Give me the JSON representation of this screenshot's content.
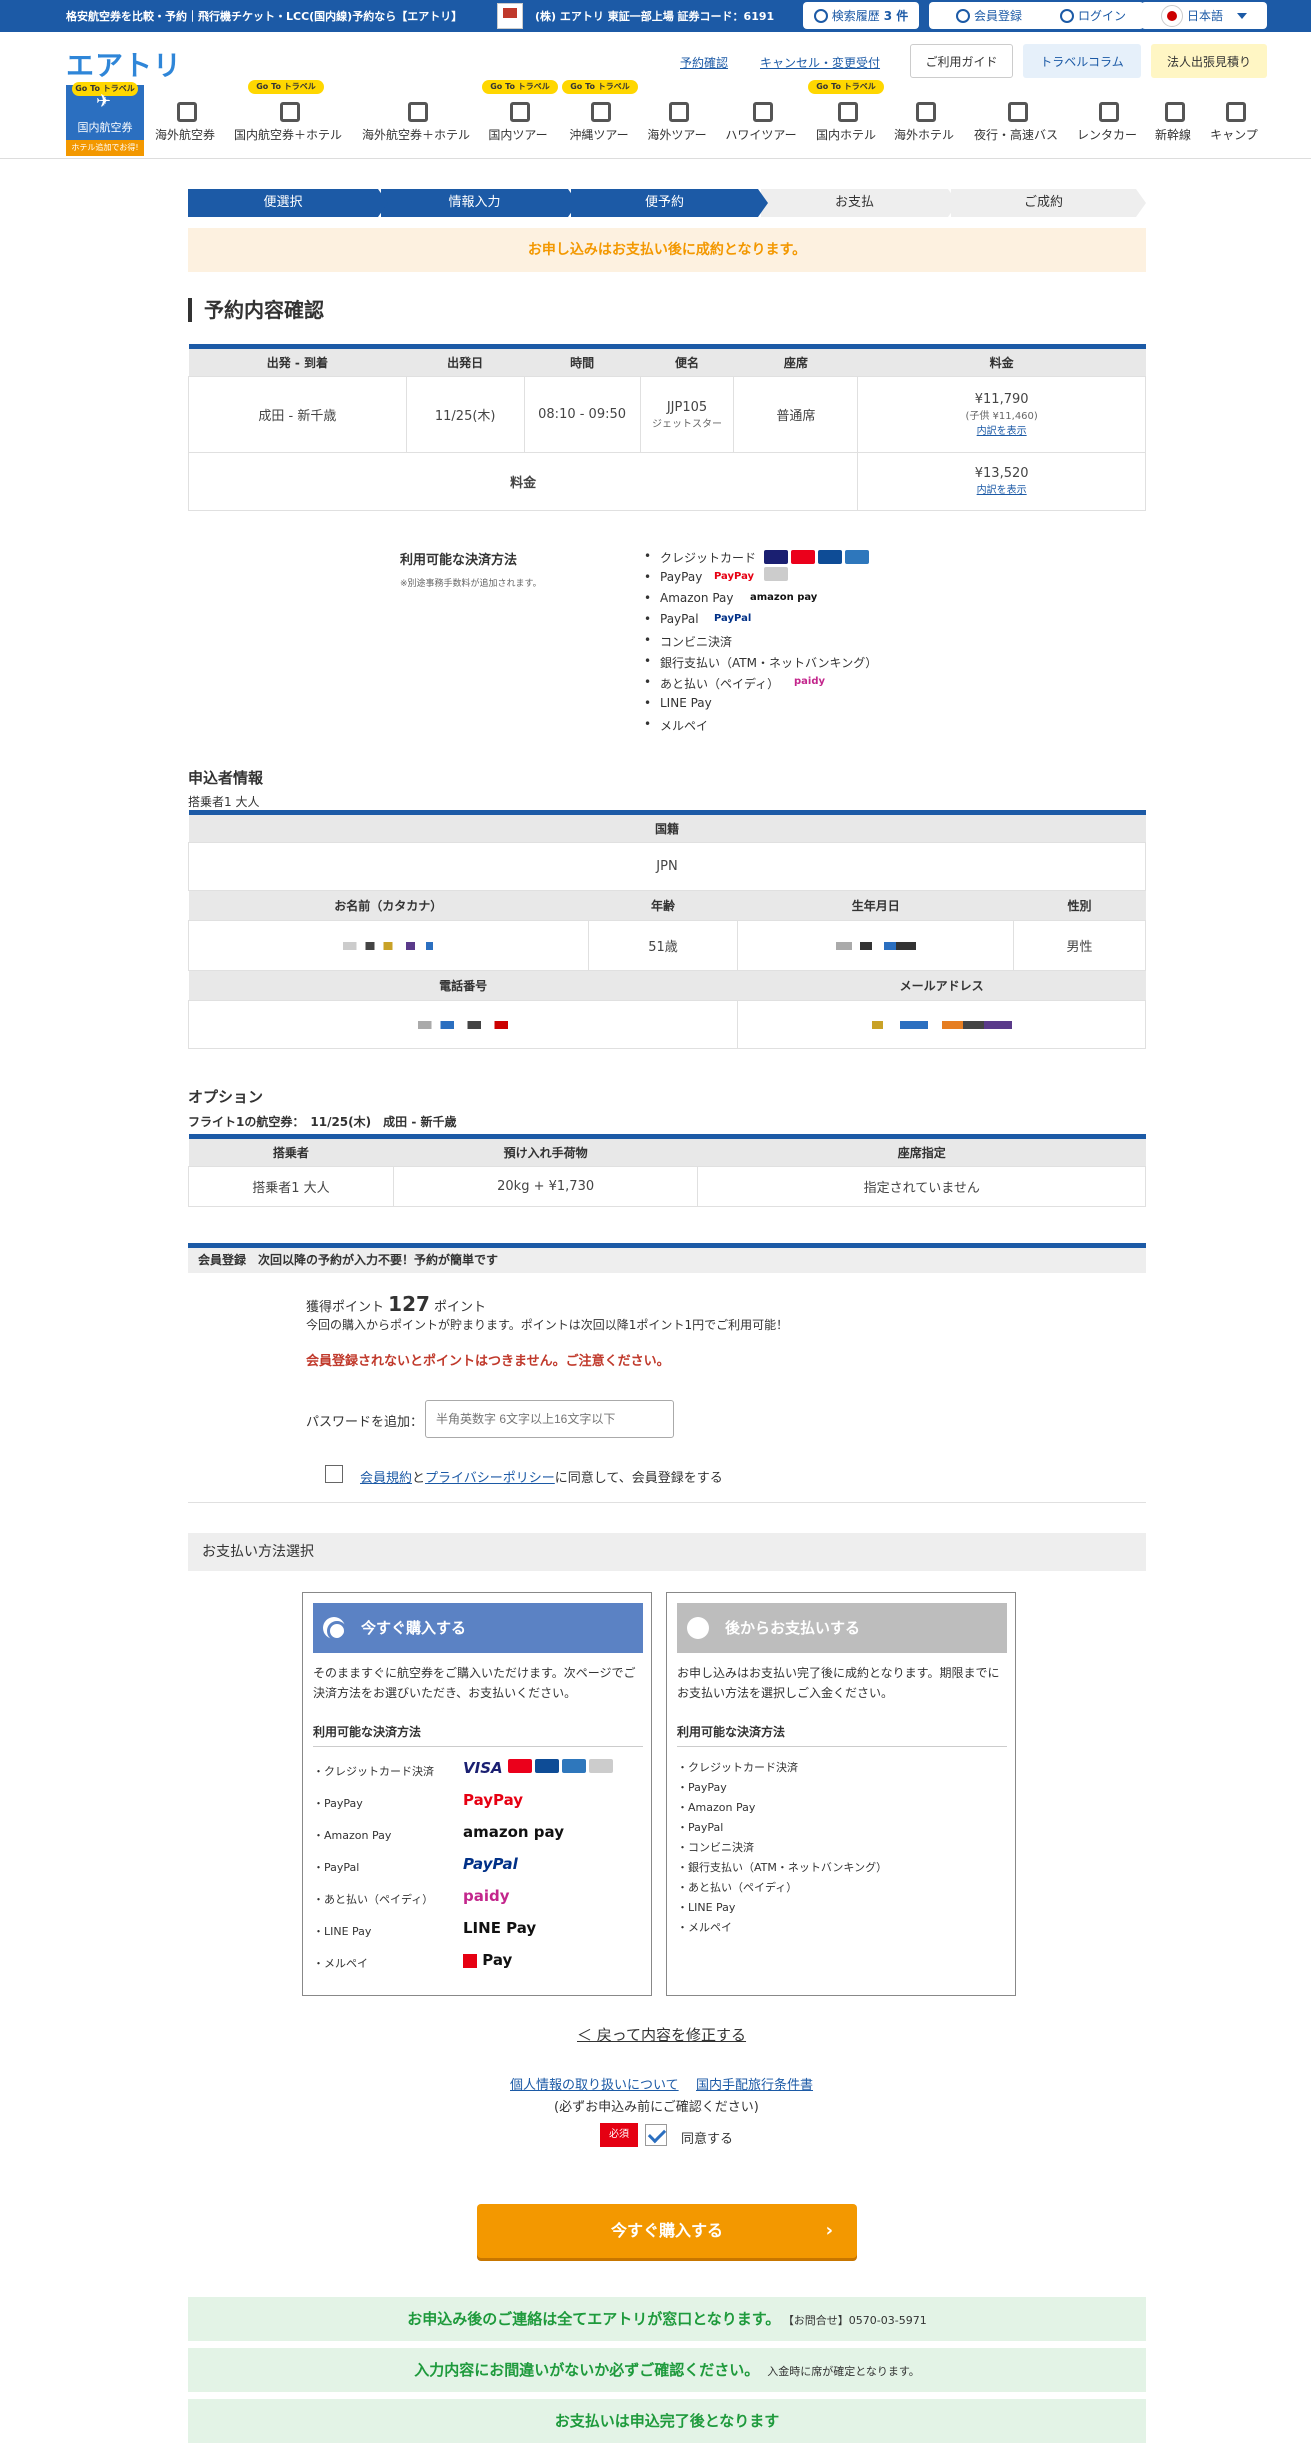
{
  "topbar": {
    "tagline": "格安航空券を比較・予約｜飛行機チケット・LCC(国内線)予約なら【エアトリ】",
    "company": "(株) エアトリ 東証一部上場 証券コード：6191",
    "history_label": "検索履歴",
    "history_count": "3 件",
    "register": "会員登録",
    "login": "ログイン",
    "lang": "日本語"
  },
  "header": {
    "logo": "エアトリ",
    "link_confirm": "予約確認",
    "link_cancel": "キャンセル・変更受付",
    "btn_guide": "ご利用ガイド",
    "btn_column": "トラベルコラム",
    "btn_corp": "法人出張見積り"
  },
  "nav": {
    "active_label": "国内航空券",
    "active_sub": "ホテル追加でお得!",
    "goto": "Go To トラベル",
    "items": [
      "海外航空券",
      "国内航空券＋ホテル",
      "海外航空券＋ホテル",
      "国内ツアー",
      "沖縄ツアー",
      "海外ツアー",
      "ハワイツアー",
      "国内ホテル",
      "海外ホテル",
      "夜行・高速バス",
      "レンタカー",
      "新幹線",
      "キャンプ"
    ]
  },
  "steps": [
    "便選択",
    "情報入力",
    "便予約",
    "お支払",
    "ご成約"
  ],
  "notice": "お申し込みはお支払い後に成約となります。",
  "confirm": {
    "title": "予約内容確認",
    "headers": [
      "出発 - 到着",
      "出発日",
      "時間",
      "便名",
      "座席",
      "料金"
    ],
    "route": "成田 - 新千歳",
    "date": "11/25(木)",
    "time": "08:10 - 09:50",
    "flight": "JJP105",
    "airline": "ジェットスター",
    "seat": "普通席",
    "price": "¥11,790",
    "child": "(子供 ¥11,460)",
    "detail": "内訳を表示",
    "total_label": "料金",
    "total": "¥13,520"
  },
  "payments": {
    "title": "利用可能な決済方法",
    "note": "※別途事務手数料が追加されます。",
    "list": [
      "クレジットカード",
      "PayPay",
      "Amazon Pay",
      "PayPal",
      "コンビニ決済",
      "銀行支払い（ATM・ネットバンキング）",
      "あと払い（ペイディ）",
      "LINE Pay",
      "メルペイ"
    ],
    "logo_paypay": "PayPay",
    "logo_amazon": "amazon pay",
    "logo_paypal": "PayPal",
    "logo_paidy": "paidy"
  },
  "applicant": {
    "title": "申込者情報",
    "pax": "搭乗者1 大人",
    "nationality_h": "国籍",
    "nationality": "JPN",
    "name_h": "お名前（カタカナ）",
    "age_h": "年齢",
    "birth_h": "生年月日",
    "sex_h": "性別",
    "age": "51歳",
    "sex": "男性",
    "tel_h": "電話番号",
    "mail_h": "メールアドレス"
  },
  "option": {
    "title": "オプション",
    "flight_label": "フライト1の航空券：",
    "date": "11/25(木)",
    "route": "成田 - 新千歳",
    "headers": [
      "搭乗者",
      "預け入れ手荷物",
      "座席指定"
    ],
    "pax": "搭乗者1 大人",
    "bag": "20kg + ¥1,730",
    "seat": "指定されていません"
  },
  "member": {
    "bar": "会員登録　次回以降の予約が入力不要！予約が簡単です",
    "points_pre": "獲得ポイント",
    "points": "127",
    "points_post": "ポイント",
    "desc": "今回の購入からポイントが貯まります。ポイントは次回以降1ポイント1円でご利用可能！",
    "warn": "会員登録されないとポイントはつきません。ご注意ください。",
    "pw_label": "パスワードを追加：",
    "pw_placeholder": "半角英数字 6文字以上16文字以下",
    "terms": "会員規約",
    "and": "と",
    "privacy": "プライバシーポリシー",
    "agree": "に同意して、会員登録をする"
  },
  "payselect": {
    "title": "お支払い方法選択",
    "now_head": "今すぐ購入する",
    "now_desc": "そのまますぐに航空券をご購入いただけます。次ページでご決済方法をお選びいただき、お支払いください。",
    "later_head": "後からお支払いする",
    "later_desc": "お申し込みはお支払い完了後に成約となります。期限までにお支払い方法を選択しご入金ください。",
    "methods_title": "利用可能な決済方法",
    "now_rows": [
      "・クレジットカード決済",
      "・PayPay",
      "・Amazon Pay",
      "・PayPal",
      "・あと払い（ペイディ）",
      "・LINE Pay",
      "・メルペイ"
    ],
    "later_rows": [
      "・クレジットカード決済",
      "・PayPay",
      "・Amazon Pay",
      "・PayPal",
      "・コンビニ決済",
      "・銀行支払い（ATM・ネットバンキング）",
      "・あと払い（ペイディ）",
      "・LINE Pay",
      "・メルペイ"
    ],
    "logos": [
      "VISA",
      "PayPay",
      "amazon pay",
      "PayPal",
      "paidy",
      "LINE Pay",
      "Pay"
    ]
  },
  "footer": {
    "back": "＜ 戻って内容を修正する",
    "policy1": "個人情報の取り扱いについて",
    "policy2": "国内手配旅行条件書",
    "note": "(必ずお申込み前にご確認ください)",
    "required": "必須",
    "agree": "同意する",
    "buy": "今すぐ購入する",
    "bar1": "お申込み後のご連絡は全てエアトリが窓口となります。",
    "bar1_s": "【お問合せ】0570-03-5971",
    "bar2": "入力内容にお間違いがないか必ずご確認ください。",
    "bar2_s": "入金時に席が確定となります。",
    "bar3": "お支払いは申込完了後となります"
  },
  "colors": {
    "primary": "#1c5aa6",
    "accent": "#f39800",
    "success": "#1e9a3c",
    "warn": "#c0392b"
  }
}
